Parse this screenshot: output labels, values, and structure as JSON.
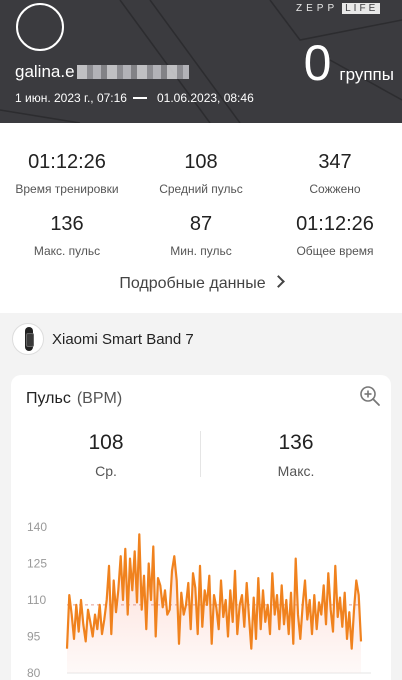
{
  "brand": {
    "part1": "ZEPP",
    "part2": "LIFE"
  },
  "header": {
    "username_visible": "galina.e",
    "start_date": "1 июн. 2023 г., 07:16",
    "end_date": "01.06.2023, 08:46",
    "groups_count": "0",
    "groups_label": "группы"
  },
  "stats": [
    {
      "value": "01:12:26",
      "label": "Время тренировки"
    },
    {
      "value": "108",
      "label": "Средний пульс"
    },
    {
      "value": "347",
      "label": "Сожжено"
    },
    {
      "value": "136",
      "label": "Макс. пульс"
    },
    {
      "value": "87",
      "label": "Мин. пульс"
    },
    {
      "value": "01:12:26",
      "label": "Общее время"
    }
  ],
  "details_link": "Подробные данные",
  "device": {
    "name": "Xiaomi Smart Band 7",
    "icon": "smart-band-icon"
  },
  "hr_card": {
    "title": "Пульс",
    "unit": "(BPM)",
    "avg_value": "108",
    "avg_label": "Ср.",
    "max_value": "136",
    "max_label": "Макс.",
    "zoom_icon": "zoom-in-icon"
  },
  "chart_data": {
    "type": "area",
    "y_ticks": [
      "140",
      "125",
      "110",
      "95",
      "80"
    ],
    "ylim": [
      80,
      140
    ],
    "average_line": 108,
    "line_color": "#f0821e",
    "fill_color": "#fcd9d2",
    "values": [
      90,
      112,
      104,
      94,
      108,
      97,
      110,
      100,
      93,
      106,
      101,
      95,
      104,
      98,
      108,
      96,
      102,
      110,
      124,
      96,
      118,
      105,
      114,
      128,
      110,
      131,
      104,
      127,
      114,
      130,
      109,
      137,
      106,
      120,
      98,
      125,
      110,
      132,
      95,
      119,
      116,
      107,
      114,
      104,
      106,
      122,
      128,
      118,
      92,
      113,
      104,
      108,
      117,
      98,
      121,
      115,
      96,
      124,
      99,
      114,
      108,
      120,
      92,
      112,
      107,
      98,
      118,
      103,
      110,
      95,
      114,
      101,
      122,
      96,
      108,
      112,
      99,
      117,
      103,
      90,
      111,
      94,
      119,
      98,
      114,
      101,
      108,
      96,
      121,
      104,
      112,
      98,
      116,
      100,
      110,
      96,
      113,
      92,
      127,
      104,
      94,
      108,
      118,
      102,
      110,
      96,
      112,
      98,
      109,
      104,
      116,
      100,
      121,
      106,
      97,
      124,
      103,
      111,
      99,
      113,
      94,
      105,
      90,
      106,
      118,
      112,
      93
    ]
  }
}
